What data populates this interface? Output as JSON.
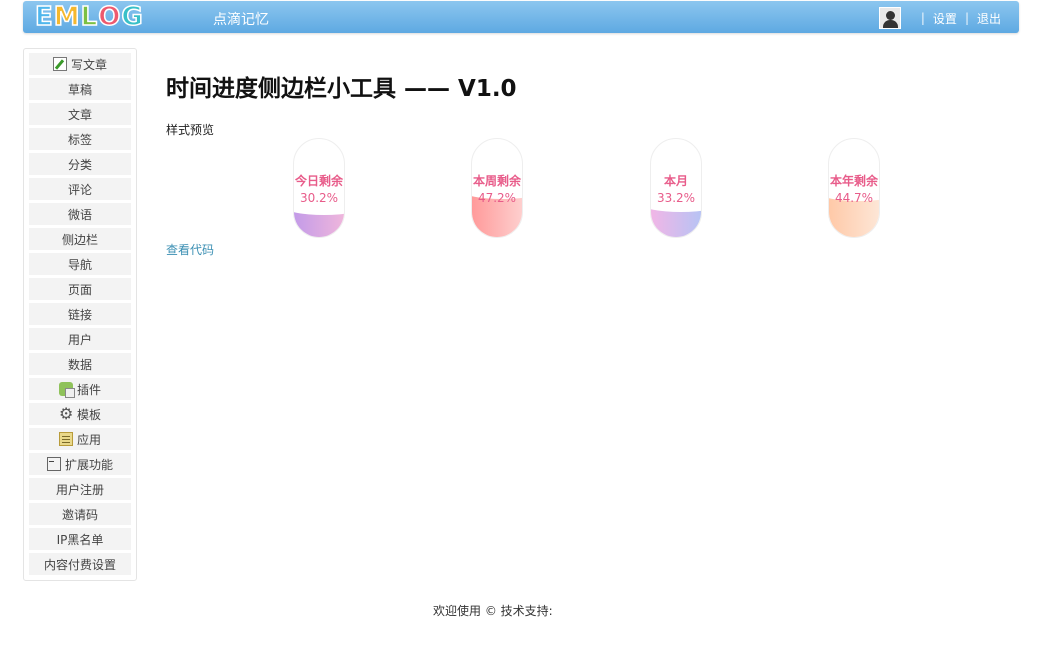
{
  "header": {
    "logo_letters": [
      "E",
      "M",
      "L",
      "O",
      "G"
    ],
    "logo_colors": [
      "#4fb6ec",
      "#f5b82e",
      "#7bc043",
      "#ee5a6e",
      "#39c0c8"
    ],
    "site_name": "点滴记忆",
    "settings_label": "设置",
    "logout_label": "退出",
    "separator": "|"
  },
  "sidebar": {
    "items": [
      {
        "label": "写文章",
        "icon": "write-icon"
      },
      {
        "label": "草稿"
      },
      {
        "label": "文章"
      },
      {
        "label": "标签"
      },
      {
        "label": "分类"
      },
      {
        "label": "评论"
      },
      {
        "label": "微语"
      },
      {
        "label": "侧边栏"
      },
      {
        "label": "导航"
      },
      {
        "label": "页面"
      },
      {
        "label": "链接"
      },
      {
        "label": "用户"
      },
      {
        "label": "数据"
      },
      {
        "label": "插件",
        "icon": "plugin-icon"
      },
      {
        "label": "模板",
        "icon": "gear-icon"
      },
      {
        "label": "应用",
        "icon": "app-icon"
      },
      {
        "label": "扩展功能",
        "icon": "collapse-icon"
      },
      {
        "label": "用户注册"
      },
      {
        "label": "邀请码"
      },
      {
        "label": "IP黑名单"
      },
      {
        "label": "内容付费设置"
      }
    ]
  },
  "main": {
    "title": "时间进度侧边栏小工具 —— V1.0",
    "preview_label": "样式预览",
    "view_code_label": "查看代码",
    "widgets": [
      {
        "label": "今日剩余",
        "percent": "30.2%",
        "value": 0.302,
        "gradient": [
          "#c39be8",
          "#efb6dc"
        ]
      },
      {
        "label": "本周剩余",
        "percent": "47.2%",
        "value": 0.472,
        "gradient": [
          "#ff9a9a",
          "#fecfce"
        ]
      },
      {
        "label": "本月",
        "percent": "33.2%",
        "value": 0.332,
        "gradient": [
          "#f1b6e6",
          "#b7c3f4"
        ]
      },
      {
        "label": "本年剩余",
        "percent": "44.7%",
        "value": 0.447,
        "gradient": [
          "#ffc9a8",
          "#fde6d6"
        ]
      }
    ]
  },
  "footer": {
    "text": "欢迎使用 © 技术支持:"
  }
}
